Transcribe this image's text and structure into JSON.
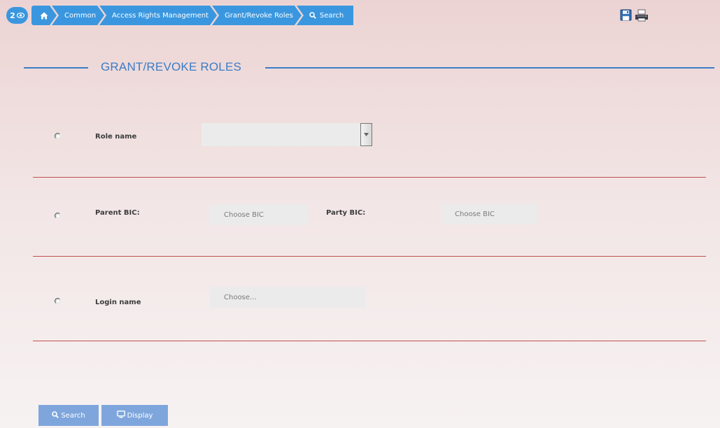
{
  "breadcrumb": {
    "counter": "2",
    "items": [
      {
        "label": "Common"
      },
      {
        "label": "Access Rights Management"
      },
      {
        "label": "Grant/Revoke Roles"
      },
      {
        "label": "Search"
      }
    ]
  },
  "page": {
    "title": "GRANT/REVOKE ROLES"
  },
  "section1": {
    "role_name_label": "Role name",
    "role_name_value": ""
  },
  "section2": {
    "parent_bic_label": "Parent BIC:",
    "parent_bic_placeholder": "Choose BIC",
    "party_bic_label": "Party BIC:",
    "party_bic_placeholder": "Choose BIC"
  },
  "section3": {
    "login_name_label": "Login name",
    "login_name_placeholder": "Choose..."
  },
  "buttons": {
    "search": "Search",
    "display": "Display"
  },
  "colors": {
    "accent": "#3a97df",
    "title": "#3a7cc7",
    "divider": "#c0504d",
    "button": "#7ea6dc"
  }
}
